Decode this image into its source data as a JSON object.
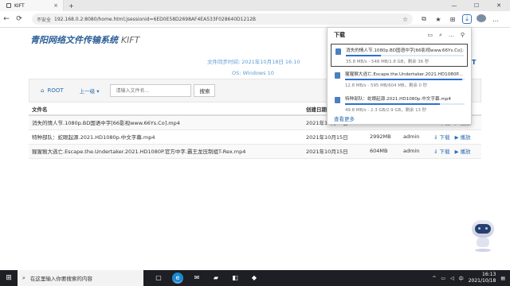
{
  "browser": {
    "tab_title": "KIFT",
    "tab_close": "×",
    "new_tab": "+",
    "win_min": "—",
    "win_max": "☐",
    "win_close": "✕",
    "back": "←",
    "refresh": "⟳",
    "insecure_label": "不安全",
    "url": "192.168.0.2:8080/home.html;jsessionid=6ED0E58D2698AF4EA533F028640D1212B"
  },
  "page": {
    "site_title": "青阳网络文件传输系统",
    "site_title_suffix": "KIFT",
    "sync_time": "文件同步时间: 2021年10月18日 16:10",
    "os": "OS: Windows 10",
    "brand_fragment": "T"
  },
  "toolbar": {
    "root_label": "ROOT",
    "up_label": "上一级 ▾",
    "search_placeholder": "请输入文件名...",
    "search_button": "搜索"
  },
  "table": {
    "headers": [
      "文件名",
      "创建日期",
      "",
      "",
      ""
    ],
    "rows": [
      {
        "name": "消失的情人节.1080p.BD国语中字[66影视www.66Ys.Co].mp4",
        "date": "2021年10月15日",
        "size": "",
        "user": "",
        "download": "下载",
        "play": "播放"
      },
      {
        "name": "特种部队：蛇眼起源.2021.HD1080p.中文字幕.mp4",
        "date": "2021年10月15日",
        "size": "",
        "user": "",
        "download": "下载",
        "play": "播放"
      },
      {
        "name": "猩猩猴大逃亡.Escape.the.Undertaker.2021.HD1080P.官方中字.霸王龙压制组T-Rex.mp4",
        "date": "2021年10月15日",
        "size": "604MB",
        "user": "admin",
        "download": "下载",
        "play": "播放"
      }
    ],
    "row2_size": "2992MB",
    "row2_user": "admin"
  },
  "downloads": {
    "title": "下载",
    "more_label": "查看更多",
    "items": [
      {
        "name": "消失的情人节.1080p.BD国语中字[66影视www.66Ys.Co].mp4",
        "status": "35.8 MB/s - 548 MB/1.8 GB，剩余 36 秒",
        "progress": 0.3
      },
      {
        "name": "猩猩猴大逃亡.Escape.the.Undertaker.2021.HD1080P...",
        "status": "12.8 MB/s - 595 MB/604 MB，剩余 0 秒",
        "progress": 0.98
      },
      {
        "name": "特种部队：蛇眼起源.2021.HD1080p.中文字幕.mp4",
        "status": "49.8 MB/s - 2.3 GB/2.9 GB，剩余 13 秒",
        "progress": 0.79
      }
    ]
  },
  "taskbar": {
    "search_text": "在这里输入你要搜索的内容",
    "time": "16:13",
    "date": "2021/10/18"
  }
}
